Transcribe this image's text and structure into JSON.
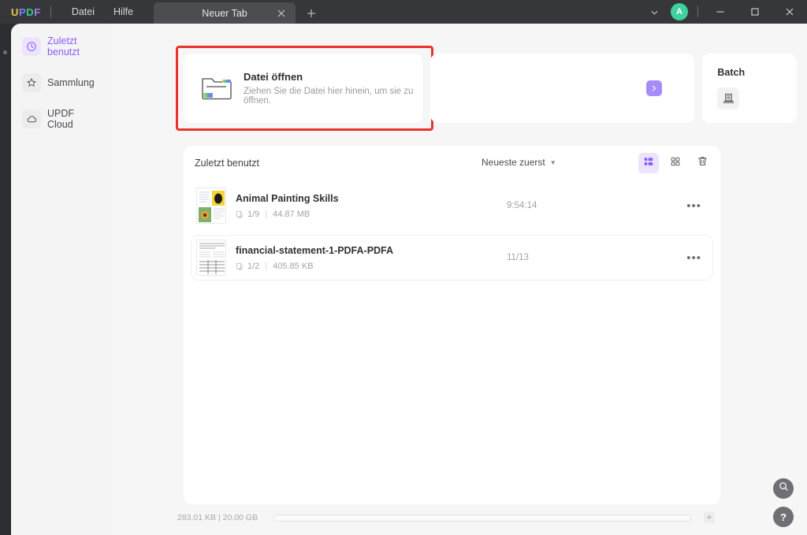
{
  "titlebar": {
    "logo": "UPDF",
    "logo_letters": [
      {
        "ch": "U",
        "color": "#f2c53d"
      },
      {
        "ch": "P",
        "color": "#6f86f5"
      },
      {
        "ch": "D",
        "color": "#3ec98a"
      },
      {
        "ch": "F",
        "color": "#a97bf0"
      }
    ],
    "menus": [
      {
        "label": "Datei",
        "name": "menu-datei"
      },
      {
        "label": "Hilfe",
        "name": "menu-hilfe"
      }
    ],
    "tab": {
      "label": "Neuer Tab",
      "close_icon": "close-icon",
      "new_tab_icon": "plus-icon"
    },
    "chevron_icon": "chevron-down-icon",
    "avatar_letter": "A",
    "avatar_color": "#3fd1a0",
    "window_controls": {
      "minimize": "minimize-icon",
      "maximize": "maximize-icon",
      "close": "close-icon"
    }
  },
  "sidebar": {
    "items": [
      {
        "label": "Zuletzt benutzt",
        "icon": "clock-icon",
        "active": true
      },
      {
        "label": "Sammlung",
        "icon": "star-icon",
        "active": false
      },
      {
        "label": "UPDF Cloud",
        "icon": "cloud-icon",
        "active": false
      }
    ],
    "active_color": "#8b5cf6"
  },
  "cards": {
    "open_file": {
      "title": "Datei öffnen",
      "subtitle": "Ziehen Sie die Datei hier hinein, um sie zu öffnen.",
      "icon": "folder-icon",
      "highlight_color": "#e8342a"
    },
    "middle": {
      "action_icon": "arrow-right-icon",
      "action_color": "#a78bfa"
    },
    "batch": {
      "title": "Batch",
      "icon": "stacked-documents-icon"
    }
  },
  "recent": {
    "title": "Zuletzt benutzt",
    "sort_label": "Neueste zuerst",
    "sort_caret": "chevron-down-icon",
    "view_buttons": [
      {
        "name": "list-view-button",
        "icon": "list-view-icon",
        "active": true
      },
      {
        "name": "grid-view-button",
        "icon": "grid-view-icon",
        "active": false
      },
      {
        "name": "delete-button",
        "icon": "trash-icon",
        "active": false
      }
    ],
    "files": [
      {
        "name": "Animal Painting Skills",
        "pages": "1/9",
        "size": "44.87 MB",
        "time": "9:54:14",
        "more_icon": "more-horizontal-icon",
        "hover": false
      },
      {
        "name": "financial-statement-1-PDFA-PDFA",
        "pages": "1/2",
        "size": "405.85 KB",
        "time": "11/13",
        "more_icon": "more-horizontal-icon",
        "hover": true
      }
    ]
  },
  "statusbar": {
    "storage": "283.01 KB | 20.00 GB",
    "add_icon": "plus-icon",
    "progress_percent": 0
  },
  "fabs": [
    {
      "name": "search-fab",
      "icon": "search-icon"
    },
    {
      "name": "help-fab",
      "icon": "question-mark-icon",
      "glyph": "?"
    }
  ]
}
